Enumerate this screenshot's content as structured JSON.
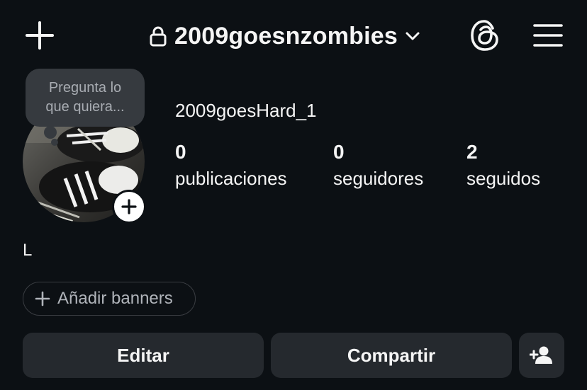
{
  "header": {
    "username": "2009goesnzombies",
    "icons": {
      "create": "plus-icon",
      "private": "lock-icon",
      "switch": "chevron-down-icon",
      "threads": "threads-icon",
      "menu": "hamburger-menu-icon"
    }
  },
  "note": {
    "text": "Pregunta lo que quiera..."
  },
  "profile": {
    "display_name": "2009goesHard_1",
    "stats": [
      {
        "value": "0",
        "label": "publicaciones"
      },
      {
        "value": "0",
        "label": "seguidores"
      },
      {
        "value": "2",
        "label": "seguidos"
      }
    ],
    "bio": "L"
  },
  "actions": {
    "add_banners": "Añadir banners",
    "edit": "Editar",
    "share": "Compartir"
  },
  "colors": {
    "background": "#0c1014",
    "button": "#25292e",
    "note_bubble": "#363a3f",
    "text": "#f5f5f5"
  }
}
